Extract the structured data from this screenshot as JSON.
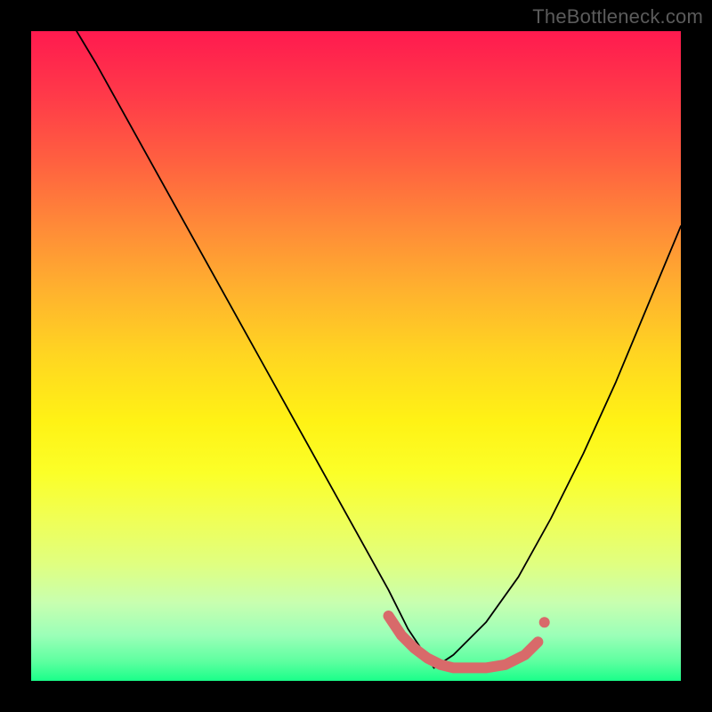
{
  "watermark": "TheBottleneck.com",
  "chart_data": {
    "type": "line",
    "title": "",
    "xlabel": "",
    "ylabel": "",
    "xlim": [
      0,
      100
    ],
    "ylim": [
      0,
      100
    ],
    "grid": false,
    "series": [
      {
        "name": "left-curve",
        "x": [
          7,
          10,
          15,
          20,
          25,
          30,
          35,
          40,
          45,
          50,
          55,
          58,
          60,
          62
        ],
        "y": [
          100,
          95,
          86,
          77,
          68,
          59,
          50,
          41,
          32,
          23,
          14,
          8,
          5,
          2
        ]
      },
      {
        "name": "right-curve",
        "x": [
          62,
          65,
          70,
          75,
          80,
          85,
          90,
          95,
          100
        ],
        "y": [
          2,
          4,
          9,
          16,
          25,
          35,
          46,
          58,
          70
        ]
      },
      {
        "name": "highlight-band",
        "x": [
          55,
          57,
          59,
          61,
          63,
          65,
          67,
          70,
          73,
          76,
          78
        ],
        "y": [
          10,
          7,
          5,
          3.5,
          2.5,
          2,
          2,
          2,
          2.5,
          4,
          6
        ]
      }
    ],
    "legend": {
      "position": "none"
    },
    "background_gradient": {
      "orientation": "vertical",
      "stops": [
        {
          "pct": 0,
          "color": "#ff1a4f"
        },
        {
          "pct": 50,
          "color": "#ffd621"
        },
        {
          "pct": 100,
          "color": "#1aff8a"
        }
      ]
    }
  },
  "colors": {
    "frame": "#000000",
    "watermark": "#5b5b5b",
    "curve": "#000000",
    "highlight": "#d86a6a"
  }
}
